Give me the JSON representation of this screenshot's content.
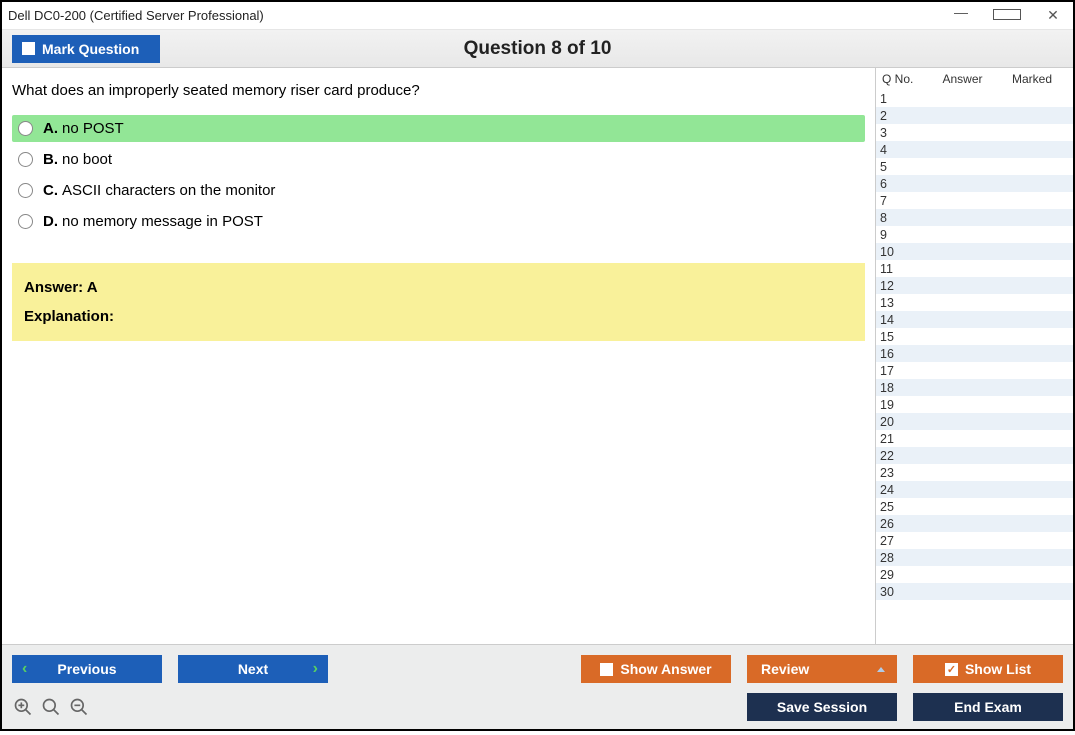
{
  "window": {
    "title": "Dell DC0-200 (Certified Server Professional)"
  },
  "header": {
    "mark_label": "Mark Question",
    "question_counter": "Question 8 of 10"
  },
  "question": {
    "text": "What does an improperly seated memory riser card produce?",
    "options": [
      {
        "letter": "A.",
        "text": "no POST",
        "highlight": true
      },
      {
        "letter": "B.",
        "text": "no boot",
        "highlight": false
      },
      {
        "letter": "C.",
        "text": "ASCII characters on the monitor",
        "highlight": false
      },
      {
        "letter": "D.",
        "text": "no memory message in POST",
        "highlight": false
      }
    ]
  },
  "answer_box": {
    "answer_label": "Answer: A",
    "explanation_label": "Explanation:"
  },
  "sidebar": {
    "columns": {
      "qno": "Q No.",
      "answer": "Answer",
      "marked": "Marked"
    },
    "rows": [
      1,
      2,
      3,
      4,
      5,
      6,
      7,
      8,
      9,
      10,
      11,
      12,
      13,
      14,
      15,
      16,
      17,
      18,
      19,
      20,
      21,
      22,
      23,
      24,
      25,
      26,
      27,
      28,
      29,
      30
    ]
  },
  "footer": {
    "previous": "Previous",
    "next": "Next",
    "show_answer": "Show Answer",
    "review": "Review",
    "show_list": "Show List",
    "save_session": "Save Session",
    "end_exam": "End Exam"
  }
}
